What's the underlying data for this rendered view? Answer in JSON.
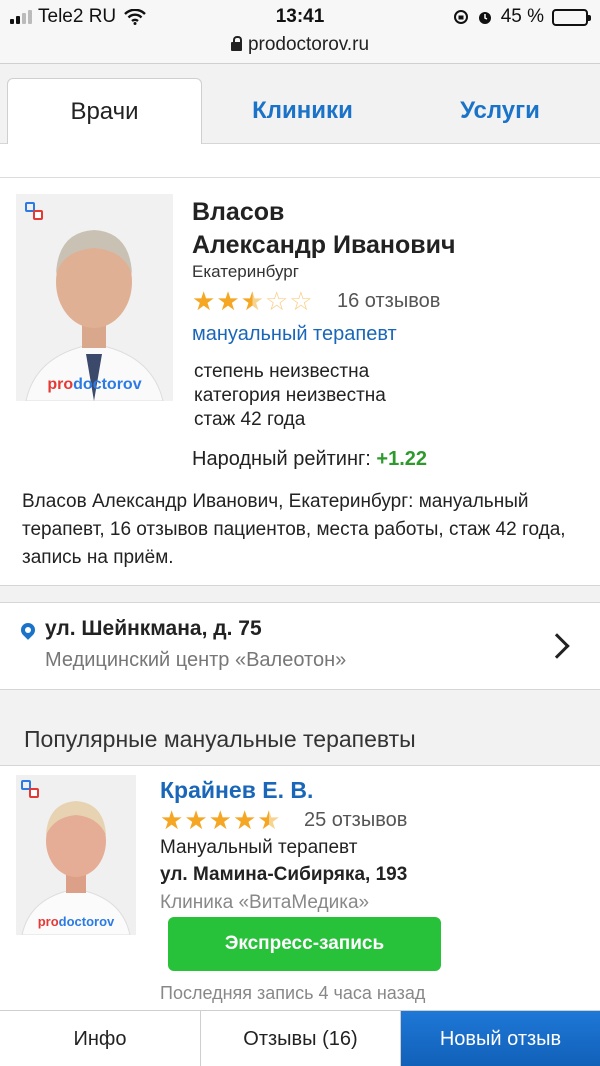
{
  "status_bar": {
    "carrier": "Tele2 RU",
    "time": "13:41",
    "battery_percent": "45 %",
    "battery_level": 0.45
  },
  "browser": {
    "url": "prodoctorov.ru"
  },
  "tabs": [
    {
      "label": "Врачи",
      "active": true
    },
    {
      "label": "Клиники",
      "active": false
    },
    {
      "label": "Услуги",
      "active": false
    }
  ],
  "doctor": {
    "surname": "Власов",
    "given_names": "Александр Иванович",
    "city": "Екатеринбург",
    "stars": 2.5,
    "reviews_label": "16 отзывов",
    "specialty": "мануальный терапевт",
    "degree": "степень неизвестна",
    "category": "категория неизвестна",
    "experience": "стаж 42 года",
    "rating_label": "Народный рейтинг:",
    "rating_value": "+1.22",
    "description": "Власов Александр Иванович, Екатеринбург: мануальный терапевт, 16 отзывов пациентов, места работы, стаж 42 года, запись на приём.",
    "photo_watermark_a": "pro",
    "photo_watermark_b": "doctorov"
  },
  "address": {
    "street": "ул. Шейнкмана, д. 75",
    "clinic": "Медицинский центр «Валеотон»"
  },
  "popular": {
    "title": "Популярные мануальные терапевты",
    "items": [
      {
        "name": "Крайнев Е. В.",
        "stars": 4.5,
        "reviews_label": "25 отзывов",
        "specialty": "Мануальный терапевт",
        "street": "ул. Мамина-Сибиряка, 193",
        "clinic": "Клиника «ВитаМедика»",
        "button_label": "Экспресс-запись",
        "last_booking": "Последняя запись 4 часа назад"
      }
    ]
  },
  "bottom_bar": {
    "info_label": "Инфо",
    "reviews_label": "Отзывы (16)",
    "new_review_label": "Новый отзыв"
  },
  "colors": {
    "link_blue": "#1a73c8",
    "star": "#f5a623",
    "rating_green": "#2e9a2e",
    "button_green": "#27c23a",
    "bottom_active": "#1565c0"
  }
}
